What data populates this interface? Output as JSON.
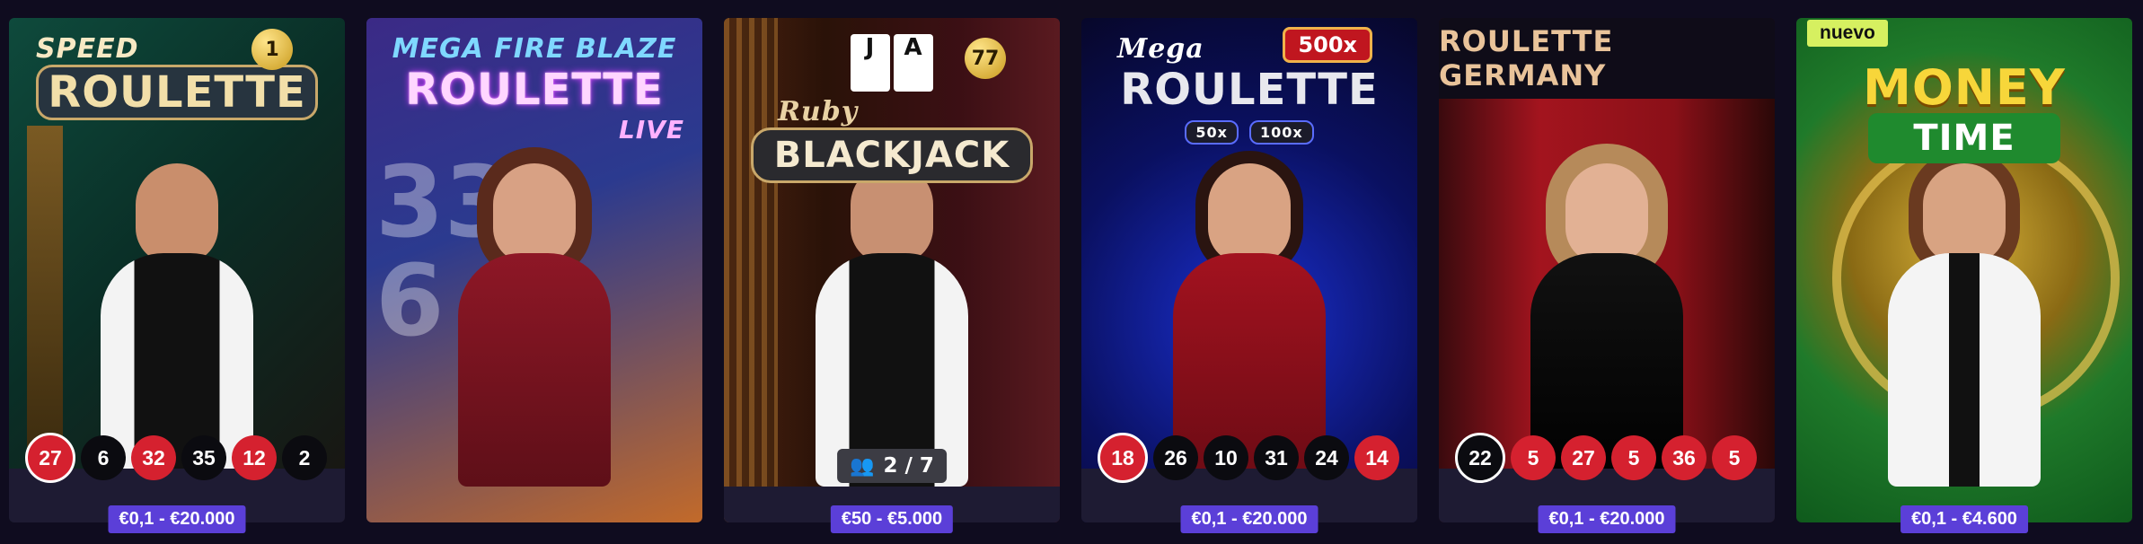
{
  "games": [
    {
      "title_small": "SPEED",
      "title_big": "ROULETTE",
      "badge": "1",
      "results": [
        {
          "n": "27",
          "c": "red"
        },
        {
          "n": "6",
          "c": "black"
        },
        {
          "n": "32",
          "c": "red"
        },
        {
          "n": "35",
          "c": "black"
        },
        {
          "n": "12",
          "c": "red"
        },
        {
          "n": "2",
          "c": "black"
        }
      ],
      "limit": "€0,1 - €20.000"
    },
    {
      "title_small": "MEGA FIRE BLAZE",
      "title_big": "ROULETTE",
      "title_sub": "LIVE",
      "limit": ""
    },
    {
      "title_small": "Ruby",
      "title_big": "BLACKJACK",
      "badge": "77",
      "seats": "2 / 7",
      "limit": "€50 - €5.000"
    },
    {
      "title_small": "Mega",
      "title_big": "ROULETTE",
      "multiplier": "500x",
      "mult_a": "50x",
      "mult_b": "100x",
      "results": [
        {
          "n": "18",
          "c": "red"
        },
        {
          "n": "26",
          "c": "black"
        },
        {
          "n": "10",
          "c": "black"
        },
        {
          "n": "31",
          "c": "black"
        },
        {
          "n": "24",
          "c": "black"
        },
        {
          "n": "14",
          "c": "red"
        }
      ],
      "limit": "€0,1 - €20.000"
    },
    {
      "header": "ROULETTE GERMANY",
      "results": [
        {
          "n": "22",
          "c": "black"
        },
        {
          "n": "5",
          "c": "red"
        },
        {
          "n": "27",
          "c": "red"
        },
        {
          "n": "5",
          "c": "red"
        },
        {
          "n": "36",
          "c": "red"
        },
        {
          "n": "5",
          "c": "red"
        }
      ],
      "limit": "€0,1 - €20.000"
    },
    {
      "tag": "nuevo",
      "title_small": "MONEY",
      "title_big": "TIME",
      "limit": "€0,1 - €4.600"
    }
  ]
}
